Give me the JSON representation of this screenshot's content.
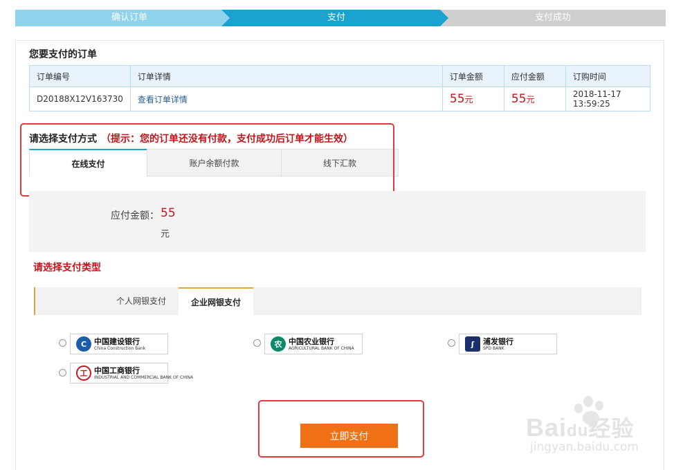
{
  "steps": [
    "确认订单",
    "支付",
    "支付成功"
  ],
  "order": {
    "title": "您要支付的订单",
    "headers": [
      "订单编号",
      "订单详情",
      "订单金额",
      "应付金额",
      "订购时间"
    ],
    "row": {
      "id": "D20188X12V163730",
      "detail_link": "查看订单详情",
      "amount": "55",
      "payable": "55",
      "unit": "元",
      "time": "2018-11-17 13:59:25"
    }
  },
  "payment": {
    "title": "请选择支付方式",
    "hint": "（提示：您的订单还没有付款，支付成功后订单才能生效）",
    "tabs": [
      "在线支付",
      "账户余额付款",
      "线下汇款"
    ],
    "amount_label": "应付金额：",
    "amount_value": "55",
    "amount_unit": "元"
  },
  "pay_type": {
    "title": "请选择支付类型",
    "tabs": [
      "个人网银支付",
      "企业网银支付"
    ]
  },
  "banks": [
    {
      "cn": "中国建设银行",
      "en": "China Construction Bank",
      "icon": "ccb-logo",
      "color": "#1d5ca8"
    },
    {
      "cn": "中国农业银行",
      "en": "AGRICULTURAL BANK OF CHINA",
      "icon": "abc-logo",
      "color": "#0b8a6a"
    },
    {
      "cn": "浦发银行",
      "en": "SPD BANK",
      "icon": "spdb-logo",
      "color": "#1a2f6b"
    },
    {
      "cn": "中国工商银行",
      "en": "INDUSTRIAL AND COMMERCIAL BANK OF CHINA",
      "icon": "icbc-logo",
      "color": "#c8161d"
    }
  ],
  "pay_button": "立即支付",
  "watermark": {
    "brand": "Bai",
    "brand2": "du",
    "cn": "经验",
    "url": "jingyan.baidu.com"
  },
  "colors": {
    "accent": "#1aa3cf",
    "price": "#c0151b",
    "button": "#f07015",
    "highlight": "#e03a3a"
  }
}
